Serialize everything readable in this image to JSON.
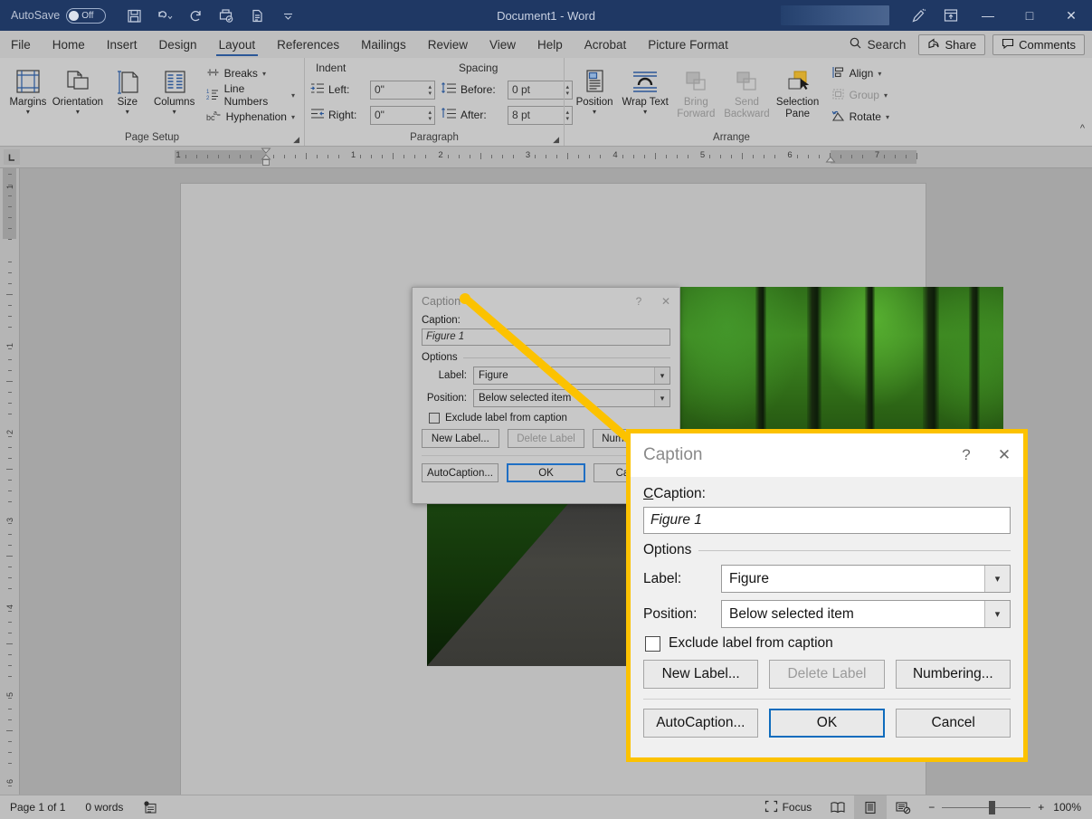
{
  "titlebar": {
    "autosave_label": "AutoSave",
    "autosave_state": "Off",
    "document_title": "Document1  -  Word",
    "qat": [
      {
        "name": "save-icon",
        "tip": "Save"
      },
      {
        "name": "undo-icon",
        "tip": "Undo"
      },
      {
        "name": "redo-icon",
        "tip": "Redo"
      },
      {
        "name": "print-preview-icon",
        "tip": "Print Preview"
      },
      {
        "name": "quick-print-icon",
        "tip": "Quick Print"
      },
      {
        "name": "customize-qat-icon",
        "tip": "Customize Quick Access Toolbar"
      }
    ],
    "right_icons": [
      {
        "name": "ink-pen-icon"
      },
      {
        "name": "ribbon-display-options-icon"
      }
    ],
    "window_buttons": {
      "minimize": "—",
      "maximize": "□",
      "close": "✕"
    }
  },
  "tabs": [
    {
      "label": "File",
      "active": false
    },
    {
      "label": "Home",
      "active": false
    },
    {
      "label": "Insert",
      "active": false
    },
    {
      "label": "Design",
      "active": false
    },
    {
      "label": "Layout",
      "active": true
    },
    {
      "label": "References",
      "active": false
    },
    {
      "label": "Mailings",
      "active": false
    },
    {
      "label": "Review",
      "active": false
    },
    {
      "label": "View",
      "active": false
    },
    {
      "label": "Help",
      "active": false
    },
    {
      "label": "Acrobat",
      "active": false
    },
    {
      "label": "Picture Format",
      "active": false
    }
  ],
  "tabbar_right": {
    "search_placeholder": "Search",
    "share_label": "Share",
    "comments_label": "Comments"
  },
  "ribbon": {
    "groups": [
      {
        "name": "page-setup",
        "label": "Page Setup",
        "big_buttons": [
          {
            "label": "Margins",
            "icon": "margins-icon",
            "has_caret": true,
            "disabled": false
          },
          {
            "label": "Orientation",
            "icon": "orientation-icon",
            "has_caret": true,
            "disabled": false
          },
          {
            "label": "Size",
            "icon": "size-icon",
            "has_caret": true,
            "disabled": false
          },
          {
            "label": "Columns",
            "icon": "columns-icon",
            "has_caret": true,
            "disabled": false
          }
        ],
        "small_items": [
          {
            "label": "Breaks",
            "icon": "breaks-icon",
            "has_caret": true
          },
          {
            "label": "Line Numbers",
            "icon": "line-numbers-icon",
            "has_caret": true
          },
          {
            "label": "Hyphenation",
            "icon": "hyphenation-icon",
            "has_caret": true
          }
        ]
      },
      {
        "name": "paragraph",
        "label": "Paragraph",
        "col_heads": [
          "Indent",
          "Spacing"
        ],
        "fields": [
          {
            "label": "Left:",
            "value": "0\"",
            "icon": "indent-left-icon"
          },
          {
            "label": "Right:",
            "value": "0\"",
            "icon": "indent-right-icon"
          },
          {
            "label": "Before:",
            "value": "0 pt",
            "icon": "spacing-before-icon"
          },
          {
            "label": "After:",
            "value": "8 pt",
            "icon": "spacing-after-icon"
          }
        ]
      },
      {
        "name": "arrange",
        "label": "Arrange",
        "big_buttons": [
          {
            "label": "Position",
            "icon": "position-icon",
            "has_caret": true,
            "disabled": false
          },
          {
            "label": "Wrap Text",
            "icon": "wrap-text-icon",
            "has_caret": true,
            "disabled": false
          },
          {
            "label": "Bring Forward",
            "icon": "bring-forward-icon",
            "has_caret": true,
            "disabled": true
          },
          {
            "label": "Send Backward",
            "icon": "send-backward-icon",
            "has_caret": true,
            "disabled": true
          },
          {
            "label": "Selection Pane",
            "icon": "selection-pane-icon",
            "has_caret": false,
            "disabled": false
          }
        ],
        "small_items": [
          {
            "label": "Align",
            "icon": "align-icon",
            "has_caret": true,
            "disabled": false
          },
          {
            "label": "Group",
            "icon": "group-icon",
            "has_caret": true,
            "disabled": true
          },
          {
            "label": "Rotate",
            "icon": "rotate-icon",
            "has_caret": true,
            "disabled": false
          }
        ]
      }
    ],
    "collapse_icon": "collapse-ribbon-icon"
  },
  "ruler": {
    "corner_label": "L",
    "h_numbers": [
      "1",
      "1",
      "2",
      "3",
      "4",
      "5",
      "6",
      "7"
    ],
    "v_numbers": [
      "1",
      "1",
      "2",
      "3",
      "4",
      "5",
      "6"
    ]
  },
  "dialog_small": {
    "title": "Caption",
    "help_glyph": "?",
    "close_glyph": "✕",
    "caption_label": "Caption:",
    "caption_value": "Figure 1",
    "options_label": "Options",
    "label_field_label": "Label:",
    "label_field_value": "Figure",
    "position_field_label": "Position:",
    "position_field_value": "Below selected item",
    "exclude_checkbox_label": "Exclude label from caption",
    "exclude_checked": false,
    "buttons_row1": [
      "New Label...",
      "Delete Label",
      "Numbering..."
    ],
    "buttons_row1_disabled": [
      false,
      true,
      false
    ],
    "buttons_row2": [
      "AutoCaption...",
      "OK",
      "Cancel"
    ]
  },
  "dialog_big": {
    "title": "Caption",
    "help_glyph": "?",
    "close_glyph": "✕",
    "caption_label": "Caption:",
    "caption_value": "Figure 1",
    "options_label": "Options",
    "label_field_label": "Label:",
    "label_field_value": "Figure",
    "position_field_label": "Position:",
    "position_field_value": "Below selected item",
    "exclude_checkbox_label": "Exclude label from caption",
    "exclude_checked": false,
    "new_label_button": "New Label...",
    "delete_label_button": "Delete Label",
    "numbering_button": "Numbering...",
    "autocaption_button": "AutoCaption...",
    "ok_button": "OK",
    "cancel_button": "Cancel",
    "highlight_color": "#fcc200",
    "accent_color": "#0f6cbd"
  },
  "statusbar": {
    "page_label": "Page 1 of 1",
    "word_count": "0 words",
    "proofing_icon": "proofing-errors-icon",
    "focus_label": "Focus",
    "view_icons": [
      "read-mode-icon",
      "print-layout-icon",
      "web-layout-icon"
    ],
    "zoom_out_glyph": "−",
    "zoom_in_glyph": "+",
    "zoom_level": "100%"
  },
  "photo": {
    "alt": "forest-road-photograph"
  }
}
